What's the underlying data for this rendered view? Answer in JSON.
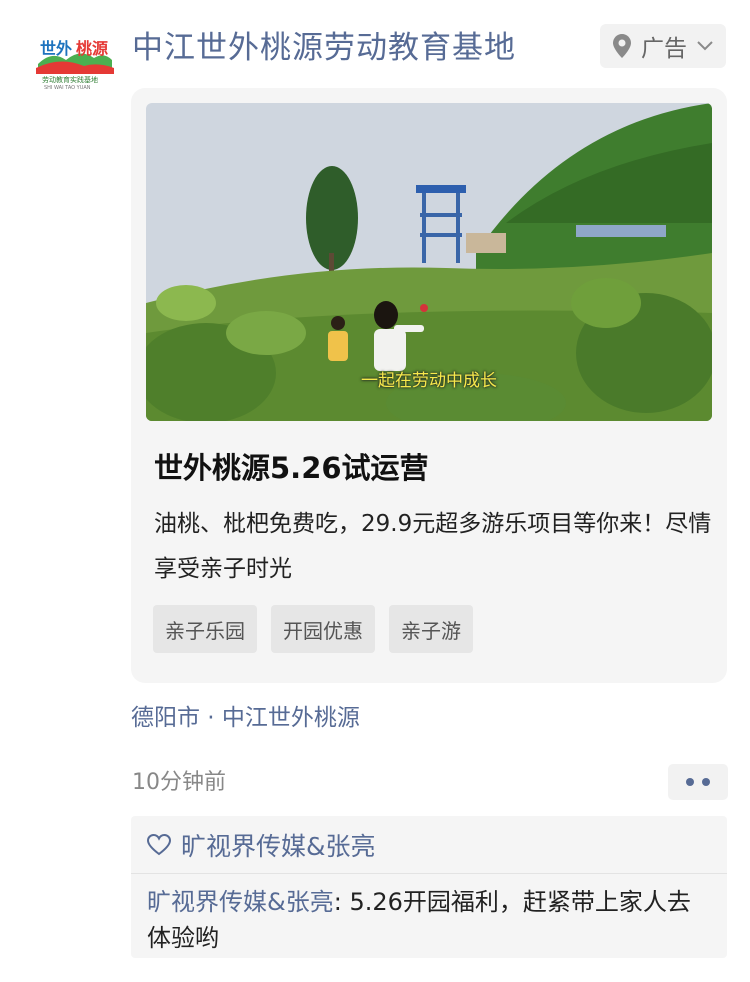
{
  "account": {
    "name": "中江世外桃源劳动教育基地",
    "logo_text": "世外桃源",
    "logo_subtext": "劳动教育实践基地",
    "logo_pinyin": "SHI WAI TAO YUAN"
  },
  "ad": {
    "label": "广告",
    "icons": [
      "location-pin-icon",
      "chevron-down-icon"
    ]
  },
  "card": {
    "photo_caption": "一起在劳动中成长",
    "title": "世外桃源5.26试运营",
    "description": "油桃、枇杷免费吃，29.9元超多游乐项目等你来！尽情享受亲子时光",
    "tags": [
      "亲子乐园",
      "开园优惠",
      "亲子游"
    ]
  },
  "location": "德阳市 · 中江世外桃源",
  "time": "10分钟前",
  "likes": {
    "icon": "heart-outline-icon",
    "names": "旷视界传媒&张亮"
  },
  "comment": {
    "author": "旷视界传媒&张亮",
    "separator": ": ",
    "text": "5.26开园福利，赶紧带上家人去体验哟"
  },
  "colors": {
    "link": "#576b95",
    "caption": "#f7e94b",
    "card_bg": "#f5f5f5"
  }
}
